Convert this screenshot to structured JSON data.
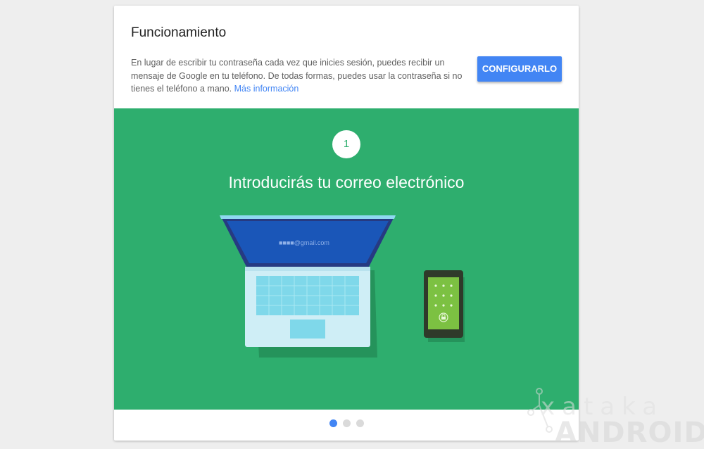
{
  "card": {
    "title": "Funcionamiento",
    "description": "En lugar de escribir tu contraseña cada vez que inicies sesión, puedes recibir un mensaje de Google en tu teléfono. De todas formas, puedes usar la contraseña si no tienes el teléfono a mano.",
    "more_info_link": "Más información",
    "configure_button": "CONFIGURARLO"
  },
  "carousel": {
    "step_number": "1",
    "step_title": "Introducirás tu correo electrónico",
    "laptop_screen_text": "■■■■@gmail.com",
    "pages": 3,
    "active_page": 1
  },
  "watermark": {
    "top": "xataka",
    "bottom": "ANDROID"
  },
  "colors": {
    "banner_green": "#2eae6e",
    "accent_blue": "#4285f4",
    "laptop_screen": "#1a56b8",
    "phone_screen": "#7cc142"
  }
}
